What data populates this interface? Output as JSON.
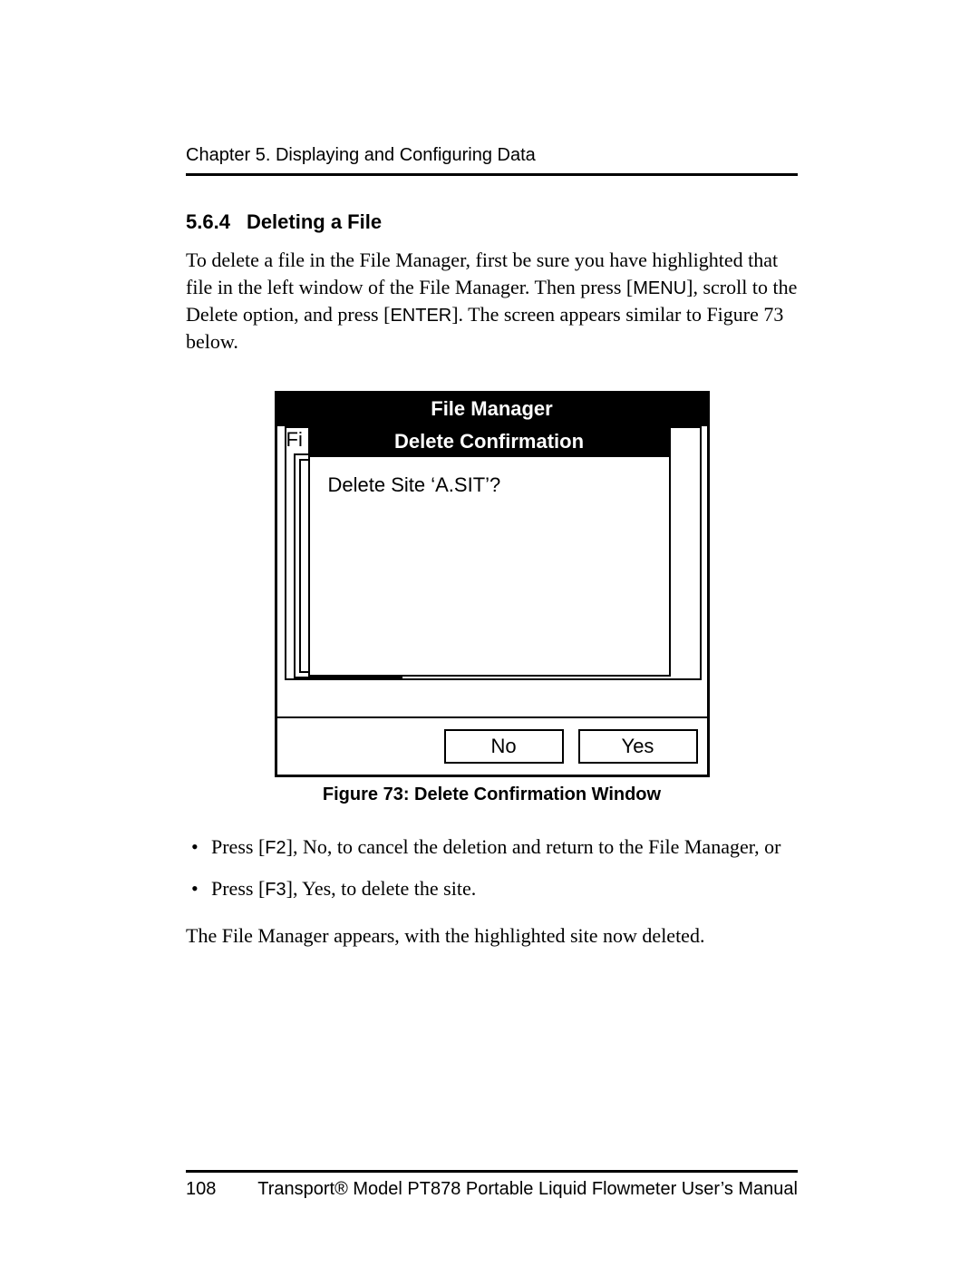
{
  "header": {
    "chapter": "Chapter 5. Displaying and Configuring Data"
  },
  "section": {
    "number": "5.6.4",
    "title": "Deleting a File"
  },
  "paragraph": {
    "pre": "To delete a file in the File Manager, first be sure you have highlighted that file in the left window of the File Manager. Then press [",
    "key1": "MENU",
    "mid": "], scroll to the Delete option, and press [",
    "key2": "ENTER",
    "post": "]. The screen appears similar to Figure 73 below."
  },
  "device": {
    "title": "File Manager",
    "bg_label": "Fi",
    "dialog_title": "Delete Confirmation",
    "dialog_message": "Delete Site ‘A.SIT’?",
    "buttons": {
      "no": "No",
      "yes": "Yes"
    }
  },
  "figure_caption": "Figure 73: Delete Confirmation Window",
  "bullets": [
    {
      "pre": "Press [",
      "key": "F2",
      "post": "], No, to cancel the deletion and return to the File Manager, or"
    },
    {
      "pre": "Press [",
      "key": "F3",
      "post": "], Yes, to delete the site."
    }
  ],
  "closing": "The File Manager appears, with the highlighted site now deleted.",
  "footer": {
    "page": "108",
    "manual": "Transport® Model PT878 Portable Liquid Flowmeter User’s Manual"
  }
}
